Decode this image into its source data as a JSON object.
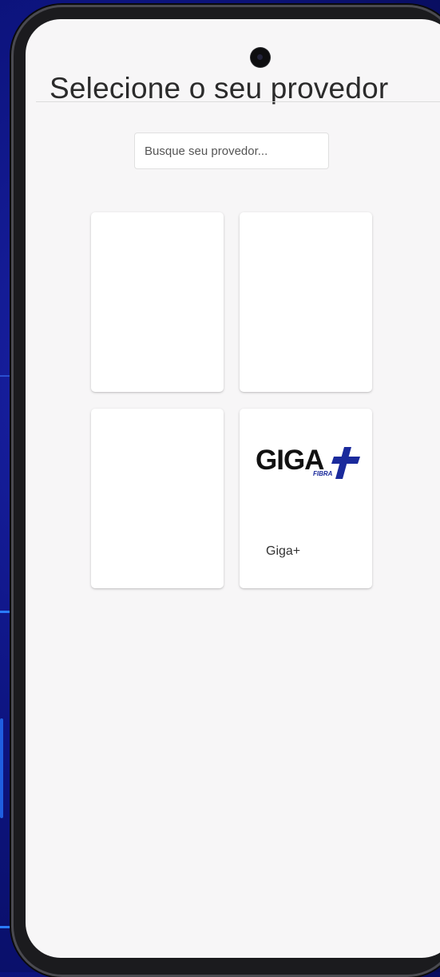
{
  "page": {
    "title": "Selecione o seu provedor"
  },
  "search": {
    "placeholder": "Busque seu provedor..."
  },
  "providers": [
    {
      "name": ""
    },
    {
      "name": ""
    },
    {
      "name": ""
    },
    {
      "name": "Giga+",
      "logo_text": "GIGA",
      "logo_sub": "FIBRA",
      "logo_accent_color": "#1a2a9c"
    }
  ],
  "colors": {
    "background": "#0d1480",
    "screen": "#f7f6f7",
    "accent": "#1a2a9c"
  }
}
